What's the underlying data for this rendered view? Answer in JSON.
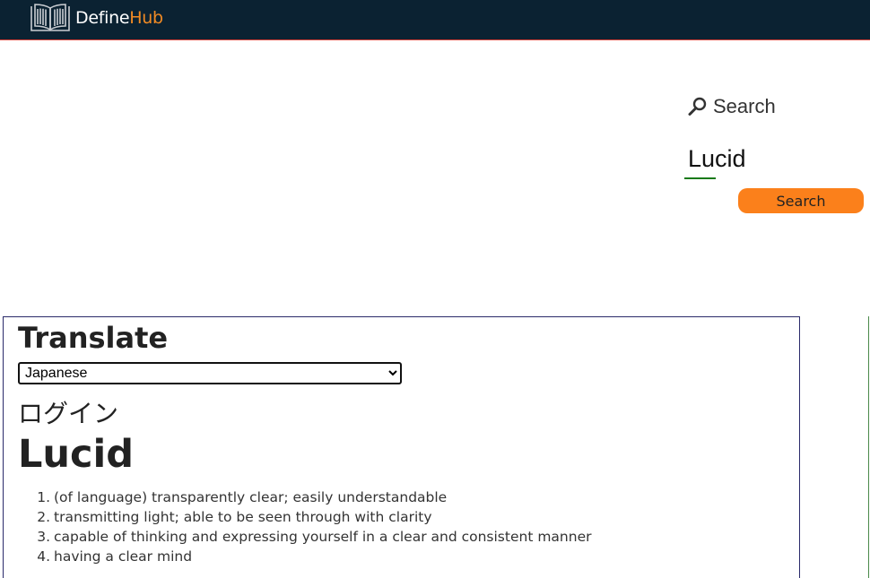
{
  "header": {
    "logo_define": "Define",
    "logo_hub": "Hub",
    "logo_icon": "open-book-icon",
    "bg_color": "#0b2232",
    "accent_color": "#f08a24"
  },
  "search": {
    "heading": "Search",
    "heading_icon": "search-icon",
    "input_value": "Lucid",
    "button_label": "Search",
    "button_color": "#fb801b"
  },
  "translate": {
    "title": "Translate",
    "selected_language": "Japanese",
    "translated_text": "ログイン"
  },
  "word": {
    "title": "Lucid",
    "definitions": [
      {
        "num": "1.",
        "text": "(of language) transparently clear; easily understandable"
      },
      {
        "num": "2.",
        "text": "transmitting light; able to be seen through with clarity"
      },
      {
        "num": "3.",
        "text": "capable of thinking and expressing yourself in a clear and consistent manner"
      },
      {
        "num": "4.",
        "text": "having a clear mind"
      }
    ]
  }
}
